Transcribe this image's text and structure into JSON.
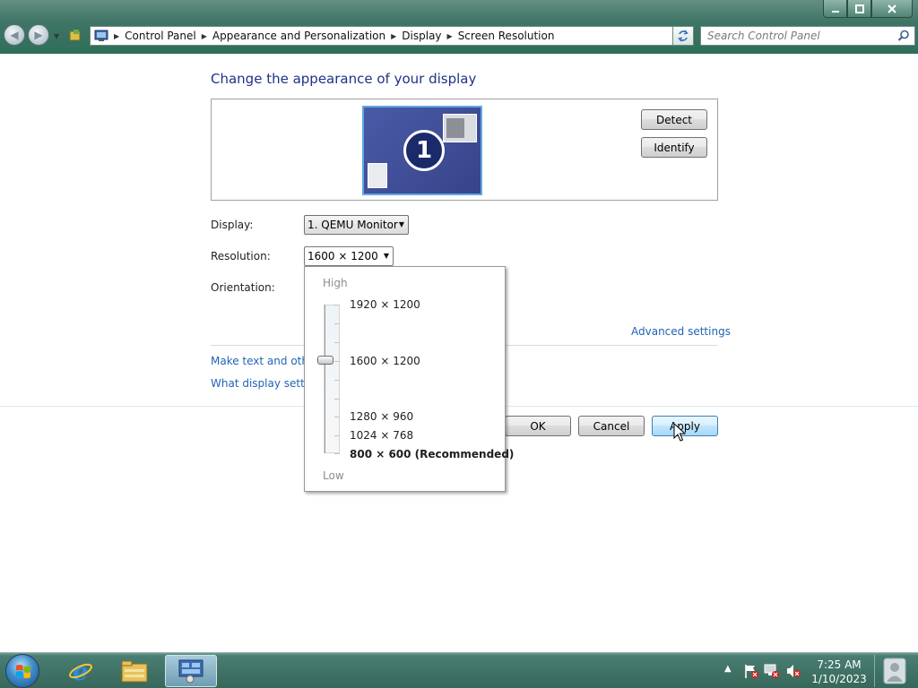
{
  "window": {
    "min_icon": "minimize-icon",
    "max_icon": "restore-icon",
    "close_icon": "close-icon"
  },
  "nav": {
    "back_icon": "back-arrow-icon",
    "forward_icon": "forward-arrow-icon"
  },
  "address": {
    "crumbs": [
      "Control Panel",
      "Appearance and Personalization",
      "Display",
      "Screen Resolution"
    ]
  },
  "search": {
    "placeholder": "Search Control Panel"
  },
  "main": {
    "heading": "Change the appearance of your display",
    "monitor_number": "1",
    "detect_label": "Detect",
    "identify_label": "Identify",
    "display_label": "Display:",
    "display_value": "1. QEMU Monitor",
    "resolution_label": "Resolution:",
    "resolution_value": "1600 × 1200",
    "orientation_label": "Orientation:",
    "advanced_link": "Advanced settings",
    "link_text_size": "Make text and other",
    "link_what_settings": "What display setting",
    "ok_label": "OK",
    "cancel_label": "Cancel",
    "apply_label": "Apply"
  },
  "resolution_dropdown": {
    "high_label": "High",
    "low_label": "Low",
    "options": [
      {
        "label": "1920 × 1200",
        "recommended": false
      },
      {
        "label": "1600 × 1200",
        "recommended": false,
        "selected": true
      },
      {
        "label": "1280 × 960",
        "recommended": false
      },
      {
        "label": "1024 × 768",
        "recommended": false
      },
      {
        "label": "800 × 600 (Recommended)",
        "recommended": true
      }
    ]
  },
  "taskbar": {
    "apps": [
      "internet-explorer-icon",
      "file-explorer-icon",
      "control-panel-icon"
    ],
    "tray": [
      "show-hidden-icons",
      "action-center-flag-icon",
      "network-icon",
      "volume-muted-icon"
    ],
    "time": "7:25 AM",
    "date": "1/10/2023"
  },
  "colors": {
    "link": "#1f64b4",
    "heading": "#1e3287",
    "chrome": "#3f7566"
  }
}
